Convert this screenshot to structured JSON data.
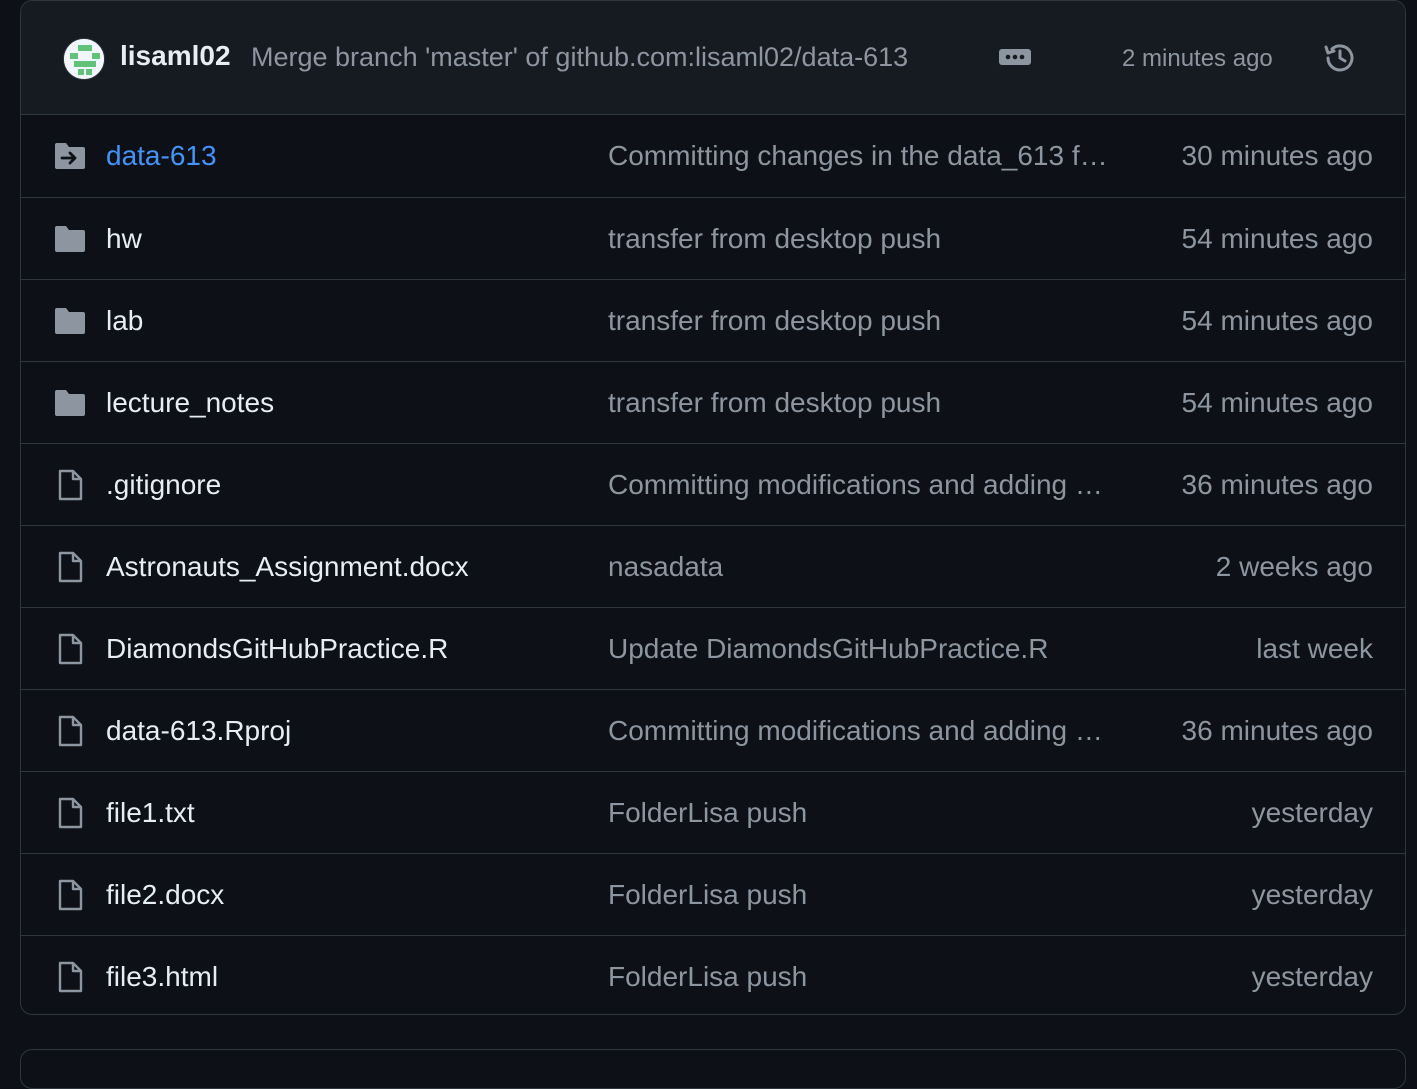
{
  "latest_commit": {
    "author": "lisaml02",
    "message": "Merge branch 'master' of github.com:lisaml02/data-613",
    "time": "2 minutes ago"
  },
  "files": [
    {
      "name": "data-613",
      "type": "submodule",
      "icon": "submodule-folder-icon",
      "message": "Committing changes in the data_613 f…",
      "time": "30 minutes ago"
    },
    {
      "name": "hw",
      "type": "folder",
      "icon": "folder-icon",
      "message": "transfer from desktop push",
      "time": "54 minutes ago"
    },
    {
      "name": "lab",
      "type": "folder",
      "icon": "folder-icon",
      "message": "transfer from desktop push",
      "time": "54 minutes ago"
    },
    {
      "name": "lecture_notes",
      "type": "folder",
      "icon": "folder-icon",
      "message": "transfer from desktop push",
      "time": "54 minutes ago"
    },
    {
      "name": ".gitignore",
      "type": "file",
      "icon": "file-icon",
      "message": "Committing modifications and adding …",
      "time": "36 minutes ago"
    },
    {
      "name": "Astronauts_Assignment.docx",
      "type": "file",
      "icon": "file-icon",
      "message": "nasadata",
      "time": "2 weeks ago"
    },
    {
      "name": "DiamondsGitHubPractice.R",
      "type": "file",
      "icon": "file-icon",
      "message": "Update DiamondsGitHubPractice.R",
      "time": "last week"
    },
    {
      "name": "data-613.Rproj",
      "type": "file",
      "icon": "file-icon",
      "message": "Committing modifications and adding …",
      "time": "36 minutes ago"
    },
    {
      "name": "file1.txt",
      "type": "file",
      "icon": "file-icon",
      "message": "FolderLisa push",
      "time": "yesterday"
    },
    {
      "name": "file2.docx",
      "type": "file",
      "icon": "file-icon",
      "message": "FolderLisa push",
      "time": "yesterday"
    },
    {
      "name": "file3.html",
      "type": "file",
      "icon": "file-icon",
      "message": "FolderLisa push",
      "time": "yesterday"
    }
  ],
  "colors": {
    "background": "#0d1117",
    "header_bg": "#161b22",
    "border": "#30363d",
    "text_primary": "#e6edf3",
    "text_muted": "#8d96a0",
    "link": "#4493f8",
    "icon": "#8d96a0"
  }
}
